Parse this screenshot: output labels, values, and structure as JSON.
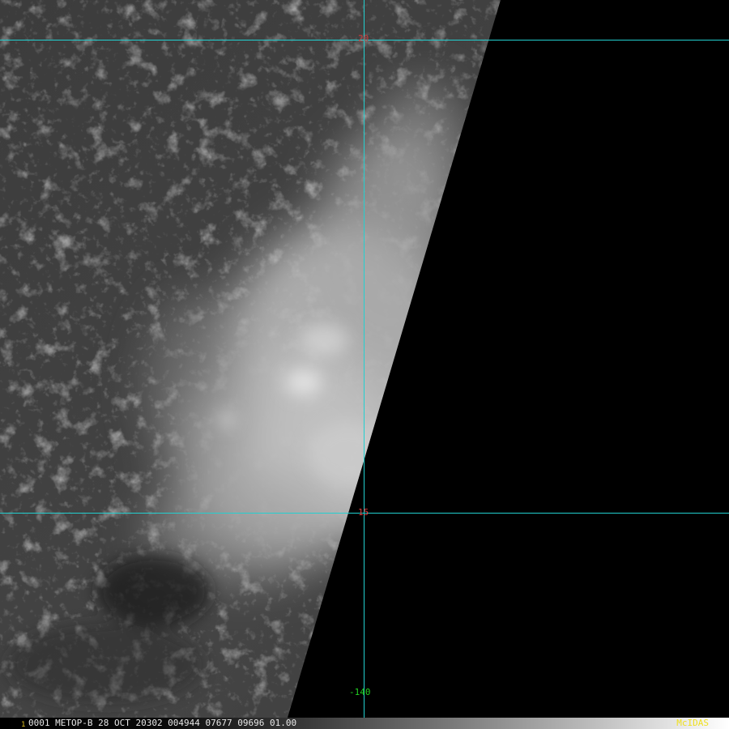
{
  "image": {
    "description_icon": "satellite-imagery",
    "colors": {
      "gridline": "#22d0d0",
      "lat_label": "#e04040",
      "lon_label": "#22d022",
      "brand": "#f0e020",
      "frame_number": "#e0c020"
    }
  },
  "grid": {
    "lat_20_label": "20",
    "lat_15_label": "15",
    "lon_140_label": "-140"
  },
  "status_bar": {
    "frame_number": "1",
    "info": "0001 METOP-B    28 OCT 20302 004944 07677 09696 01.00",
    "brand": "McIDAS"
  }
}
